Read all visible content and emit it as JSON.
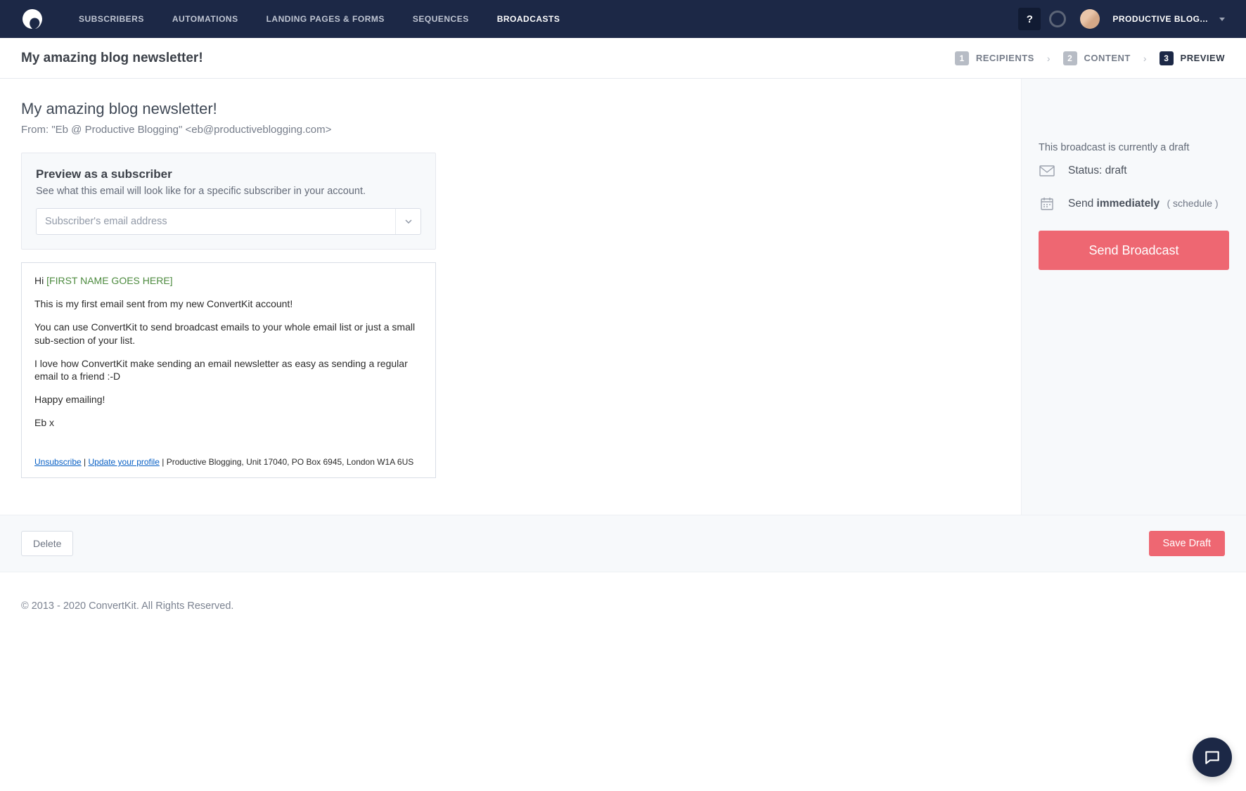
{
  "nav": {
    "items": [
      "SUBSCRIBERS",
      "AUTOMATIONS",
      "LANDING PAGES & FORMS",
      "SEQUENCES",
      "BROADCASTS"
    ],
    "active_index": 4,
    "help": "?",
    "account": "PRODUCTIVE BLOG..."
  },
  "subheader": {
    "title": "My amazing blog newsletter!",
    "steps": [
      {
        "num": "1",
        "label": "RECIPIENTS"
      },
      {
        "num": "2",
        "label": "CONTENT"
      },
      {
        "num": "3",
        "label": "PREVIEW"
      }
    ],
    "active_step": 2
  },
  "page": {
    "email_title": "My amazing blog newsletter!",
    "from_line": "From: \"Eb @ Productive Blogging\" <eb@productiveblogging.com>",
    "preview_heading": "Preview as a subscriber",
    "preview_desc": "See what this email will look like for a specific subscriber in your account.",
    "subscriber_placeholder": "Subscriber's email address"
  },
  "email": {
    "greeting_prefix": "Hi ",
    "merge_tag": "[FIRST NAME GOES HERE]",
    "p1": "This is my first email sent from my new ConvertKit account!",
    "p2": "You can use ConvertKit to send broadcast emails to your whole email list or just a small sub-section of your list.",
    "p3": "I love how ConvertKit make sending an email newsletter as easy as sending a regular email to a friend :-D",
    "p4": "Happy emailing!",
    "p5": "Eb x",
    "unsubscribe": "Unsubscribe",
    "update_profile": "Update your profile",
    "address": "Productive Blogging, Unit 17040, PO Box 6945, London W1A 6US"
  },
  "sidebar": {
    "draft_note": "This broadcast is currently a draft",
    "status_label": "Status: ",
    "status_value": "draft",
    "send_prefix": "Send ",
    "send_value": "immediately",
    "schedule_open": "( ",
    "schedule": "schedule",
    "schedule_close": " )",
    "send_button": "Send Broadcast"
  },
  "bottom": {
    "delete": "Delete",
    "save": "Save Draft"
  },
  "footer": {
    "copyright": "© 2013 - 2020 ConvertKit. All Rights Reserved."
  }
}
